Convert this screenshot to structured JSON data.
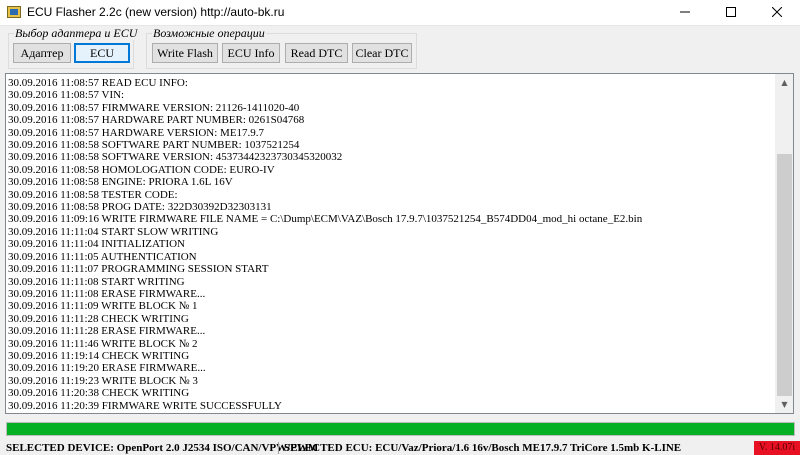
{
  "window": {
    "title": "ECU Flasher 2.2c (new version) http://auto-bk.ru",
    "controls": {
      "minimize": "–",
      "maximize": "☐",
      "close": "✕"
    }
  },
  "groups": {
    "adapter_ecu": {
      "label": "Выбор адаптера и ECU",
      "buttons": {
        "adapter": "Адаптер",
        "ecu": "ECU"
      }
    },
    "operations": {
      "label": "Возможные операции",
      "buttons": {
        "write_flash": "Write Flash",
        "ecu_info": "ECU Info",
        "read_dtc": "Read DTC",
        "clear_dtc": "Clear DTC"
      }
    }
  },
  "log": [
    "30.09.2016 11:08:57 READ ECU INFO:",
    "30.09.2016 11:08:57 VIN:",
    "30.09.2016 11:08:57 FIRMWARE VERSION: 21126-1411020-40",
    "30.09.2016 11:08:57 HARDWARE PART NUMBER: 0261S04768",
    "30.09.2016 11:08:57 HARDWARE VERSION: ME17.9.7",
    "30.09.2016 11:08:58 SOFTWARE PART NUMBER: 1037521254",
    "30.09.2016 11:08:58 SOFTWARE VERSION: 45373442323730345320032",
    "30.09.2016 11:08:58 HOMOLOGATION CODE: EURO-IV",
    "30.09.2016 11:08:58 ENGINE: PRIORA 1.6L 16V",
    "30.09.2016 11:08:58 TESTER CODE:",
    "30.09.2016 11:08:58 PROG DATE: 322D30392D32303131",
    "30.09.2016 11:09:16 WRITE FIRMWARE FILE NAME = C:\\Dump\\ECM\\VAZ\\Bosch 17.9.7\\1037521254_B574DD04_mod_hi octane_E2.bin",
    "30.09.2016 11:11:04 START SLOW WRITING",
    "30.09.2016 11:11:04 INITIALIZATION",
    "30.09.2016 11:11:05 AUTHENTICATION",
    "30.09.2016 11:11:07 PROGRAMMING SESSION START",
    "30.09.2016 11:11:08 START WRITING",
    "30.09.2016 11:11:08 ERASE FIRMWARE...",
    "30.09.2016 11:11:09 WRITE BLOCK № 1",
    "30.09.2016 11:11:28 CHECK WRITING",
    "30.09.2016 11:11:28 ERASE FIRMWARE...",
    "30.09.2016 11:11:46 WRITE BLOCK № 2",
    "30.09.2016 11:19:14 CHECK WRITING",
    "30.09.2016 11:19:20 ERASE FIRMWARE...",
    "30.09.2016 11:19:23 WRITE BLOCK № 3",
    "30.09.2016 11:20:38 CHECK WRITING",
    "30.09.2016 11:20:39 FIRMWARE WRITE SUCCESSFULLY"
  ],
  "progress": {
    "percent": 100,
    "color": "#06b025"
  },
  "status": {
    "device": "SELECTED DEVICE: OpenPort 2.0 J2534 ISO/CAN/VPW/PWM",
    "ecu": "SELECTED ECU: ECU/Vaz/Priora/1.6 16v/Bosch ME17.9.7 TriCore 1.5mb K-LINE",
    "version": "V. 14.07i"
  },
  "colors": {
    "accent": "#0078d7",
    "version_bg": "#e81123"
  }
}
